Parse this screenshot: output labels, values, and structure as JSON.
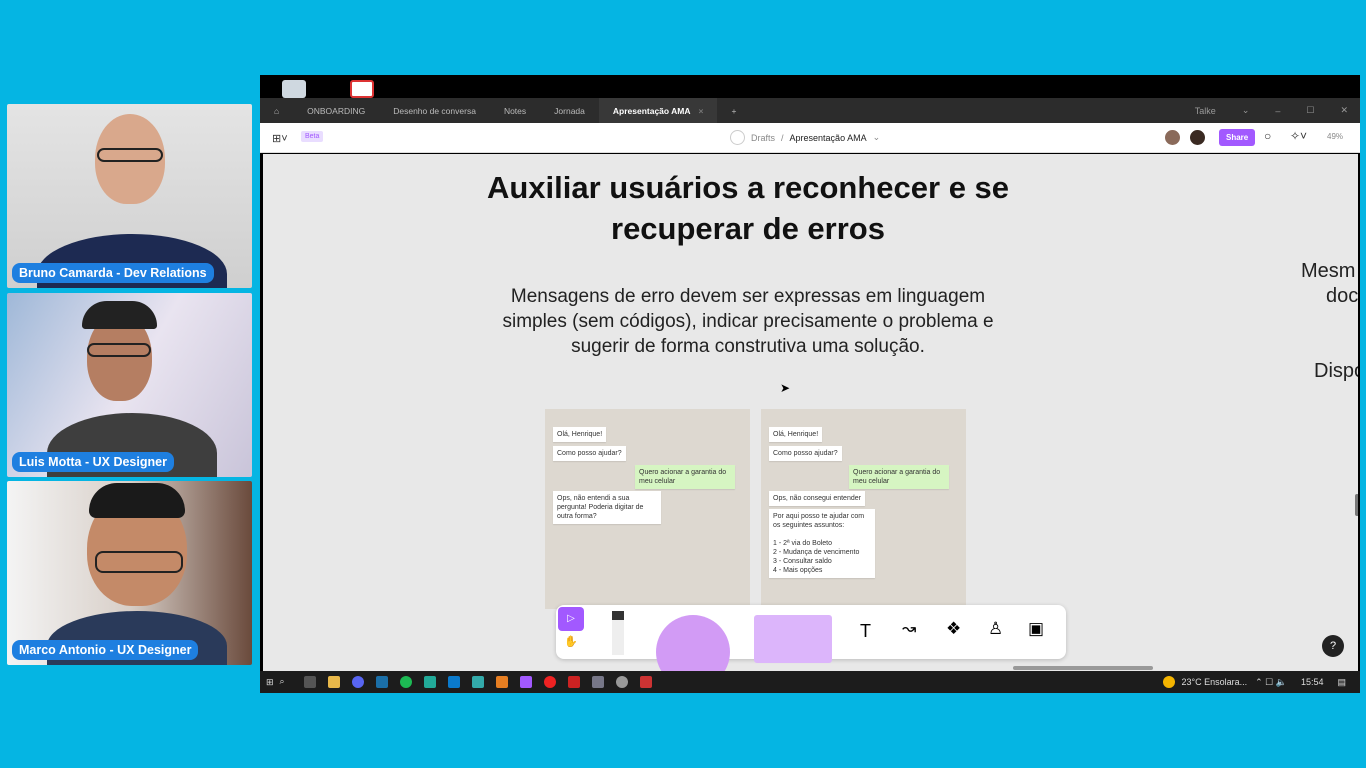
{
  "participants": [
    {
      "name": "Bruno Camarda - Dev Relations"
    },
    {
      "name": "Luis Motta - UX Designer"
    },
    {
      "name": "Marco Antonio - UX Designer"
    }
  ],
  "app": {
    "tabs": [
      "ONBOARDING",
      "Desenho de conversa",
      "Notes",
      "Jornada",
      "Apresentação AMA"
    ],
    "active_tab": "Apresentação AMA",
    "user": "Talke",
    "beta_badge": "Beta",
    "breadcrumb": {
      "root": "Drafts",
      "sep": "/",
      "file": "Apresentação AMA"
    },
    "share_label": "Share",
    "zoom": "49%",
    "accent": "#a259ff"
  },
  "slide": {
    "title_line1": "Auxiliar usuários a reconhecer e se",
    "title_line2": "recuperar de erros",
    "body": [
      "Mensagens de erro devem ser expressas em linguagem",
      "simples (sem códigos), indicar precisamente o problema e",
      "sugerir de forma construtiva uma solução."
    ],
    "side_text": [
      "Mesm",
      "doc",
      "Dispo"
    ],
    "chat_left": [
      "Olá, Henrique!",
      "Como posso ajudar?",
      "Quero acionar a garantia do meu celular",
      "Ops, não entendi a sua pergunta! Poderia digitar de outra forma?"
    ],
    "chat_right": [
      "Olá, Henrique!",
      "Como posso ajudar?",
      "Quero acionar a garantia do meu celular",
      "Ops, não consegui entender",
      "Por aqui posso te ajudar com os seguintes assuntos:",
      "1 - 2ª via do Boleto",
      "2 - Mudança de vencimento",
      "3 - Consultar saldo",
      "4 - Mais opções"
    ]
  },
  "help_label": "?",
  "taskbar": {
    "weather": "23°C  Ensolara...",
    "time": "15:54"
  }
}
